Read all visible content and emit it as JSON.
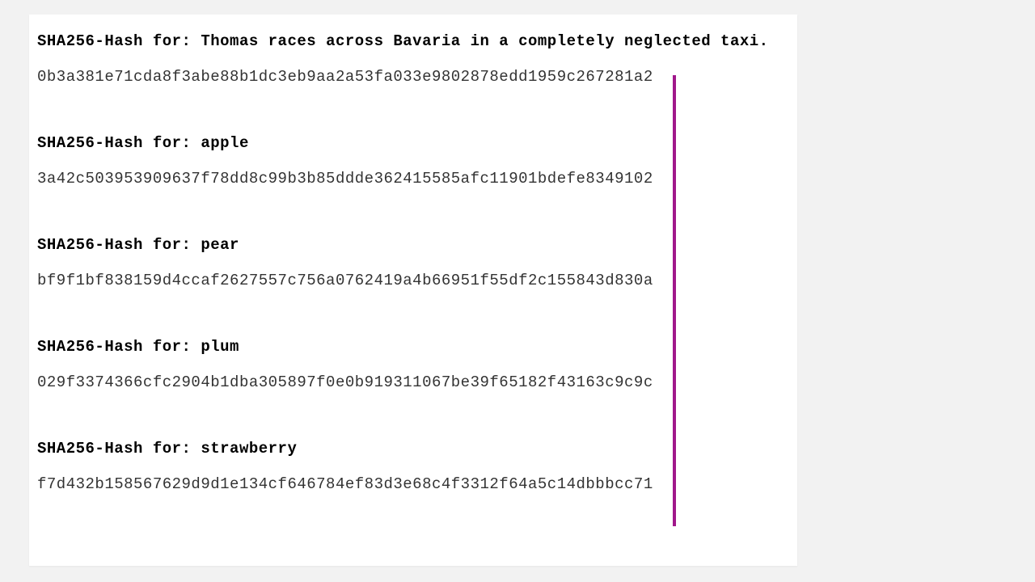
{
  "label_prefix": "SHA256-Hash for: ",
  "entries": [
    {
      "input": "Thomas races across Bavaria in a completely neglected taxi.",
      "hash": "0b3a381e71cda8f3abe88b1dc3eb9aa2a53fa033e9802878edd1959c267281a2"
    },
    {
      "input": "apple",
      "hash": "3a42c503953909637f78dd8c99b3b85ddde362415585afc11901bdefe8349102"
    },
    {
      "input": "pear",
      "hash": "bf9f1bf838159d4ccaf2627557c756a0762419a4b66951f55df2c155843d830a"
    },
    {
      "input": "plum",
      "hash": "029f3374366cfc2904b1dba305897f0e0b919311067be39f65182f43163c9c9c"
    },
    {
      "input": "strawberry",
      "hash": "f7d432b158567629d9d1e134cf646784ef83d3e68c4f3312f64a5c14dbbbcc71"
    }
  ],
  "accent_color": "#a0178b"
}
